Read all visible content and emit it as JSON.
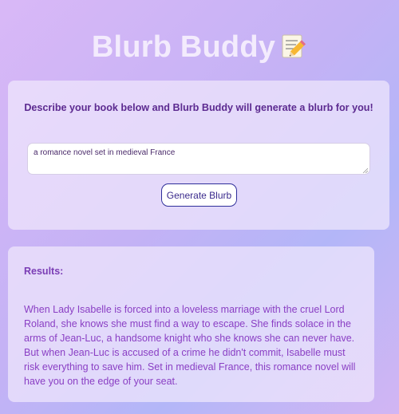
{
  "app": {
    "title": "Blurb Buddy",
    "title_icon": "memo-pencil-icon"
  },
  "form": {
    "prompt": "Describe your book below and Blurb Buddy will generate a blurb for you!",
    "input_value": "a romance novel set in medieval France",
    "button_label": "Generate Blurb"
  },
  "results": {
    "label": "Results:",
    "text": "When Lady Isabelle is forced into a loveless marriage with the cruel Lord Roland, she knows she must find a way to escape. She finds solace in the arms of Jean-Luc, a handsome knight who she knows she can never have. But when Jean-Luc is accused of a crime he didn't commit, Isabelle must risk everything to save him. Set in medieval France, this romance novel will have you on the edge of your seat."
  },
  "colors": {
    "title": "#f3ebfd",
    "prompt": "#5c2a90",
    "results_label": "#7a3db5",
    "results_text": "#8a3fc4",
    "button_border": "#2f2f9a"
  }
}
